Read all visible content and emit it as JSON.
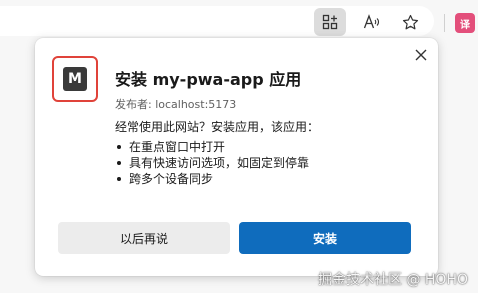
{
  "toolbar": {
    "icons": [
      "app-available-icon",
      "read-aloud-icon",
      "favorite-star-icon",
      "translate-extension-icon"
    ],
    "extension_label": "译"
  },
  "dialog": {
    "app_icon_letter": "M",
    "title": "安装 my-pwa-app 应用",
    "publisher": "发布者: localhost:5173",
    "intro": "经常使用此网站？安装应用，该应用：",
    "features": [
      "在重点窗口中打开",
      "具有快速访问选项，如固定到停靠",
      "跨多个设备同步"
    ],
    "secondary_button": "以后再说",
    "primary_button": "安装"
  },
  "watermark": "掘金技术社区 @ HOHO",
  "colors": {
    "primary": "#0f6cbd",
    "highlight_frame": "#e0433a",
    "app_icon_bg": "#3a3a3a"
  }
}
